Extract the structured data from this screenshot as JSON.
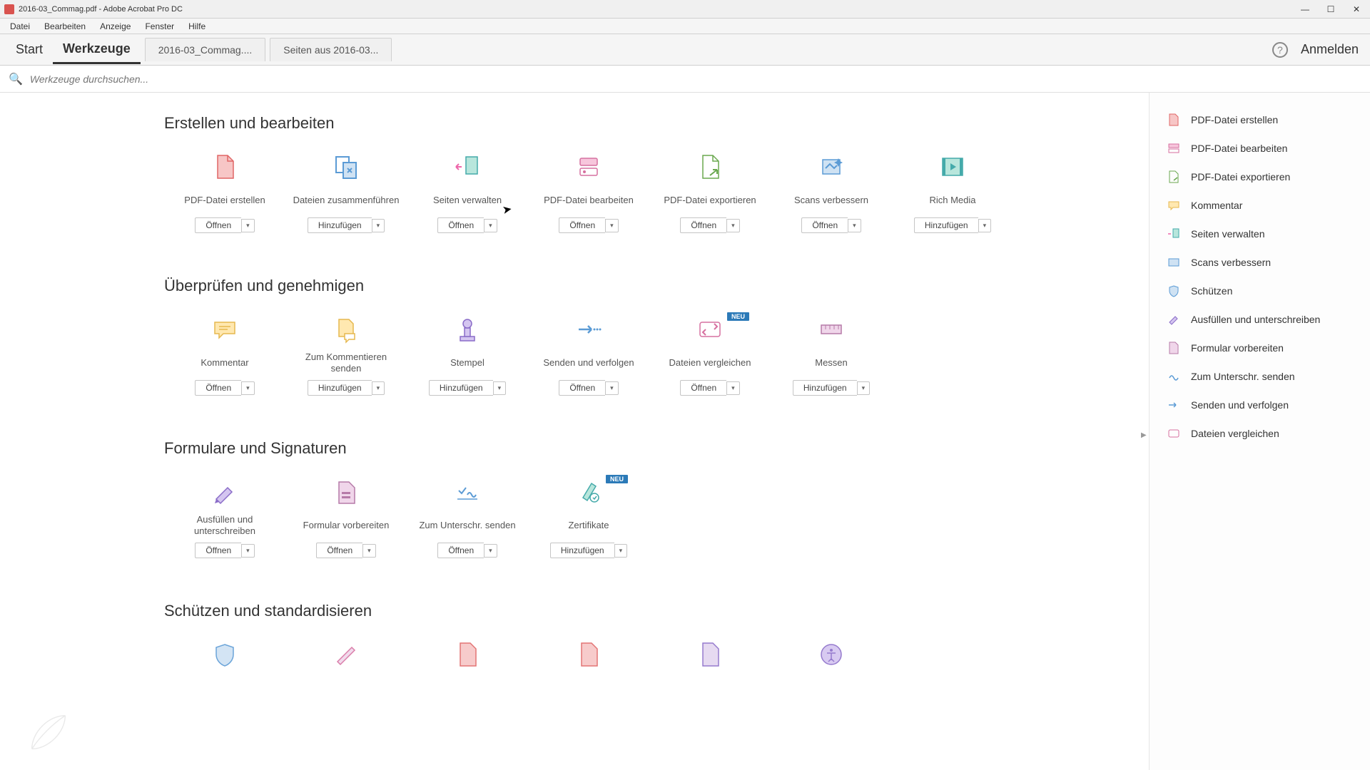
{
  "titlebar": {
    "title": "2016-03_Commag.pdf - Adobe Acrobat Pro DC"
  },
  "menubar": {
    "items": [
      "Datei",
      "Bearbeiten",
      "Anzeige",
      "Fenster",
      "Hilfe"
    ]
  },
  "tabbar": {
    "tabs": [
      "Start",
      "Werkzeuge"
    ],
    "doc_tabs": [
      "2016-03_Commag....",
      "Seiten aus 2016-03..."
    ],
    "login": "Anmelden"
  },
  "search": {
    "placeholder": "Werkzeuge durchsuchen..."
  },
  "actions": {
    "open": "Öffnen",
    "add": "Hinzufügen",
    "dd": "▾",
    "neu": "NEU"
  },
  "sections": {
    "create": {
      "title": "Erstellen und bearbeiten",
      "tools": [
        {
          "label": "PDF-Datei erstellen",
          "btn": "open"
        },
        {
          "label": "Dateien zusammenführen",
          "btn": "add"
        },
        {
          "label": "Seiten verwalten",
          "btn": "open"
        },
        {
          "label": "PDF-Datei bearbeiten",
          "btn": "open"
        },
        {
          "label": "PDF-Datei exportieren",
          "btn": "open"
        },
        {
          "label": "Scans verbessern",
          "btn": "open"
        },
        {
          "label": "Rich Media",
          "btn": "add"
        }
      ]
    },
    "review": {
      "title": "Überprüfen und genehmigen",
      "tools": [
        {
          "label": "Kommentar",
          "btn": "open"
        },
        {
          "label": "Zum Kommentieren senden",
          "btn": "add"
        },
        {
          "label": "Stempel",
          "btn": "add"
        },
        {
          "label": "Senden und verfolgen",
          "btn": "open"
        },
        {
          "label": "Dateien vergleichen",
          "btn": "open",
          "neu": true
        },
        {
          "label": "Messen",
          "btn": "add"
        }
      ]
    },
    "forms": {
      "title": "Formulare und Signaturen",
      "tools": [
        {
          "label": "Ausfüllen und unterschreiben",
          "btn": "open"
        },
        {
          "label": "Formular vorbereiten",
          "btn": "open"
        },
        {
          "label": "Zum Unterschr. senden",
          "btn": "open"
        },
        {
          "label": "Zertifikate",
          "btn": "add",
          "neu": true
        }
      ]
    },
    "protect": {
      "title": "Schützen und standardisieren"
    }
  },
  "sidebar": {
    "items": [
      "PDF-Datei erstellen",
      "PDF-Datei bearbeiten",
      "PDF-Datei exportieren",
      "Kommentar",
      "Seiten verwalten",
      "Scans verbessern",
      "Schützen",
      "Ausfüllen und unterschreiben",
      "Formular vorbereiten",
      "Zum Unterschr. senden",
      "Senden und verfolgen",
      "Dateien vergleichen"
    ]
  }
}
